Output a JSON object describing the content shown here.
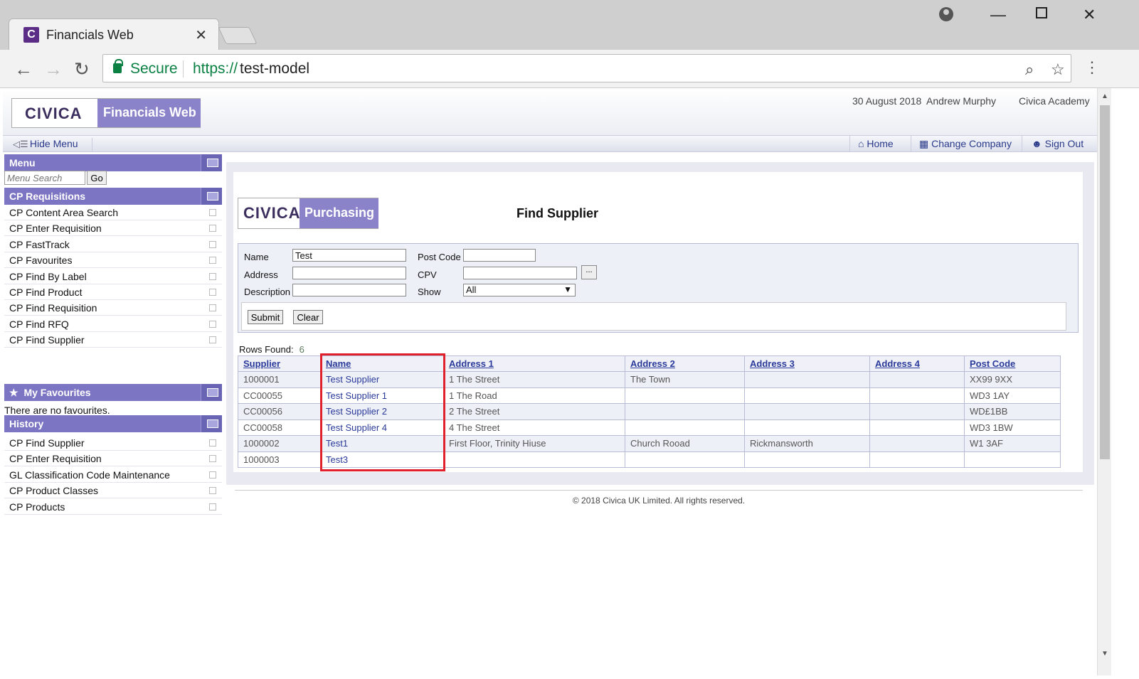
{
  "browser": {
    "tab_title": "Financials Web",
    "tab_favicon": "C",
    "secure_label": "Secure",
    "url_scheme": "https://",
    "url_host": "test-model"
  },
  "header": {
    "logo_text": "CIVICA",
    "product_name": "Financials Web",
    "date": "30 August 2018",
    "user": "Andrew Murphy",
    "company": "Civica Academy"
  },
  "menubar": {
    "hide_menu": "Hide Menu",
    "home": "Home",
    "change_company": "Change Company",
    "sign_out": "Sign Out"
  },
  "sidebar": {
    "menu_title": "Menu",
    "search_placeholder": "Menu Search",
    "go_label": "Go",
    "requisitions_title": "CP Requisitions",
    "requisitions_items": [
      "CP Content Area Search",
      "CP Enter Requisition",
      "CP FastTrack",
      "CP Favourites",
      "CP Find By Label",
      "CP Find Product",
      "CP Find Requisition",
      "CP Find RFQ",
      "CP Find Supplier"
    ],
    "favourites_title": "My Favourites",
    "no_favourites": "There are no favourites.",
    "history_title": "History",
    "history_items": [
      "CP Find Supplier",
      "CP Enter Requisition",
      "GL Classification Code Maintenance",
      "CP Product Classes",
      "CP Products"
    ]
  },
  "main": {
    "logo_text": "CIVICA",
    "product_name": "Purchasing",
    "title": "Find Supplier",
    "form": {
      "name_label": "Name",
      "name_value": "Test",
      "address_label": "Address",
      "address_value": "",
      "description_label": "Description",
      "description_value": "",
      "postcode_label": "Post Code",
      "postcode_value": "",
      "cpv_label": "CPV",
      "cpv_value": "",
      "browse_label": "...",
      "show_label": "Show",
      "show_value": "All",
      "submit_label": "Submit",
      "clear_label": "Clear"
    },
    "rows_found_label": "Rows Found:",
    "rows_found_count": "6",
    "table": {
      "columns": [
        "Supplier",
        "Name",
        "Address 1",
        "Address 2",
        "Address 3",
        "Address 4",
        "Post Code"
      ],
      "rows": [
        [
          "1000001",
          "Test Supplier",
          "1 The Street",
          "The Town",
          "",
          "",
          "XX99 9XX"
        ],
        [
          "CC00055",
          "Test Supplier 1",
          "1 The Road",
          "",
          "",
          "",
          "WD3 1AY"
        ],
        [
          "CC00056",
          "Test Supplier 2",
          "2 The Street",
          "",
          "",
          "",
          "WD£1BB"
        ],
        [
          "CC00058",
          "Test Supplier 4",
          "4 The Street",
          "",
          "",
          "",
          "WD3 1BW"
        ],
        [
          "1000002",
          "Test1",
          "First Floor, Trinity Hiuse",
          "Church Rooad",
          "Rickmansworth",
          "",
          "W1 3AF"
        ],
        [
          "1000003",
          "Test3",
          "",
          "",
          "",
          "",
          ""
        ]
      ]
    },
    "footer": "© 2018 Civica UK Limited. All rights reserved."
  },
  "colors": {
    "brand_purple": "#7b75c3",
    "link_blue": "#2a3a9a",
    "highlight_red": "#e0202a"
  }
}
